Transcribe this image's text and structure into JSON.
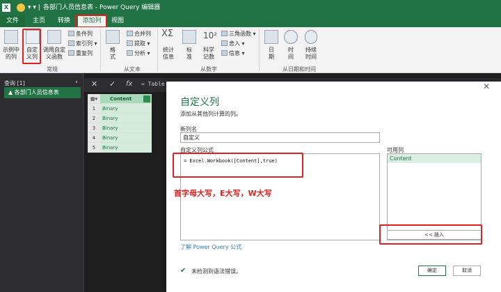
{
  "window": {
    "title": "各部门人员信息表 - Power Query 编辑器",
    "app_icon_text": "X"
  },
  "menu": {
    "tabs": [
      "文件",
      "主页",
      "转换",
      "添加列",
      "视图"
    ],
    "active_tab": "添加列"
  },
  "ribbon": {
    "general": {
      "example_col": "示例中\n的列",
      "custom_col": "自定\n义列",
      "invoke_func": "调用自定\n义函数",
      "conditional": "条件列",
      "index": "索引列",
      "duplicate": "重复列",
      "group_label": "常规"
    },
    "text": {
      "format": "格\n式",
      "merge": "合并列",
      "extract": "提取",
      "parse": "分析",
      "group_label": "从文本"
    },
    "number": {
      "stats": "统计\n信息",
      "standard": "标\n准",
      "scientific": "科学\n记数",
      "trig": "三角函数",
      "rounding": "舍入",
      "info": "信息",
      "group_label": "从数字"
    },
    "datetime": {
      "date": "日\n期",
      "time": "时\n间",
      "duration": "持续\n时间",
      "group_label": "从日期和时间"
    }
  },
  "queries": {
    "header": "查询 [1]",
    "items": [
      "各部门人员信息表"
    ]
  },
  "formula_bar": {
    "prefix": "= Table"
  },
  "table": {
    "column": "Content",
    "rows": [
      {
        "index": "1",
        "value": "Binary"
      },
      {
        "index": "2",
        "value": "Binary"
      },
      {
        "index": "3",
        "value": "Binary"
      },
      {
        "index": "4",
        "value": "Binary"
      },
      {
        "index": "5",
        "value": "Binary"
      }
    ]
  },
  "dialog": {
    "title": "自定义列",
    "subtitle": "添加从其他列计算的列。",
    "new_col_label": "新列名",
    "new_col_value": "自定义",
    "formula_label": "自定义列公式",
    "formula": "= Excel.Workbook([Content],true)",
    "annotation": "首字母大写，E大写，W大写",
    "available_label": "可用列",
    "available_columns": [
      "Content"
    ],
    "insert_button": "<< 插入",
    "learn_link": "了解 Power Query 公式",
    "status": "未检测到语法错误。",
    "ok": "确定",
    "cancel": "取消"
  },
  "colors": {
    "excel_green": "#217346",
    "annotation_red": "#e02020",
    "grid_green": "#d5ecdd",
    "dialog_title": "#217346"
  }
}
